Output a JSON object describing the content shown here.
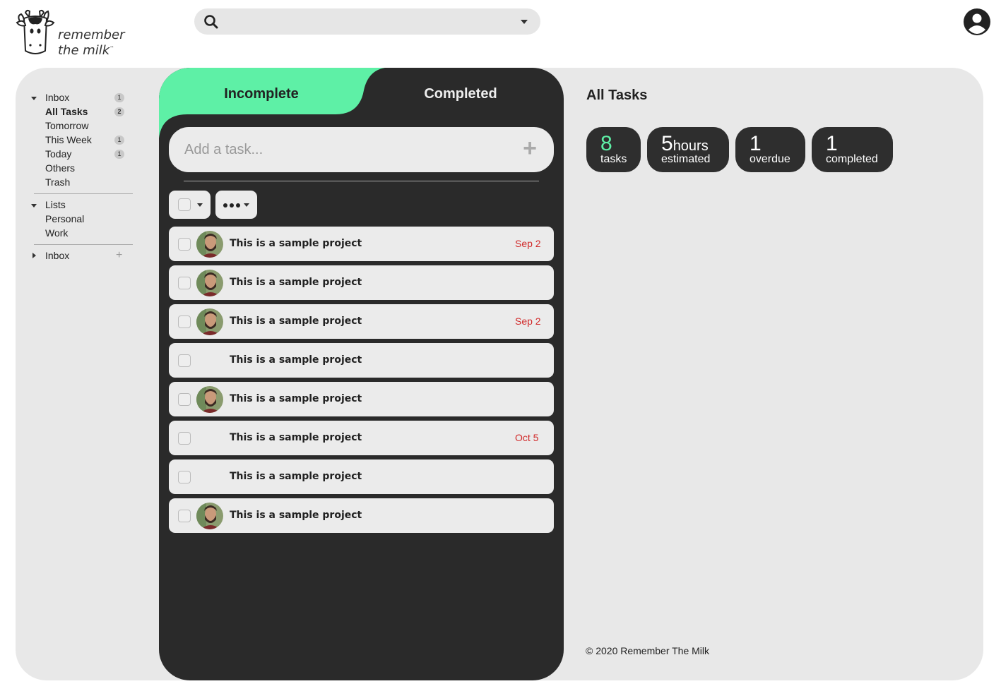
{
  "brand": {
    "line1": "remember",
    "line2": "the milk",
    "tm": "™"
  },
  "search": {
    "placeholder": ""
  },
  "sidebar": {
    "groups": [
      {
        "label": "Inbox",
        "badge": "1"
      },
      {
        "label": "All Tasks",
        "badge": "2"
      },
      {
        "label": "Tomorrow",
        "badge": ""
      },
      {
        "label": "This Week",
        "badge": "1"
      },
      {
        "label": "Today",
        "badge": "1"
      },
      {
        "label": "Others",
        "badge": ""
      },
      {
        "label": "Trash",
        "badge": ""
      }
    ],
    "lists_header": "Lists",
    "lists": [
      "Personal",
      "Work"
    ],
    "inbox2": "Inbox",
    "inbox2_add": "+"
  },
  "tabs": {
    "incomplete": "Incomplete",
    "completed": "Completed"
  },
  "add_task": {
    "placeholder": "Add a task...",
    "plus": "+"
  },
  "tasks": [
    {
      "title": "This is a sample project",
      "due": "Sep 2",
      "avatar": true
    },
    {
      "title": "This is a sample project",
      "due": "",
      "avatar": true
    },
    {
      "title": "This is a sample project",
      "due": "Sep 2",
      "avatar": true
    },
    {
      "title": "This is a sample project",
      "due": "",
      "avatar": false
    },
    {
      "title": "This is a sample project",
      "due": "",
      "avatar": true
    },
    {
      "title": "This is a sample project",
      "due": "Oct 5",
      "avatar": false
    },
    {
      "title": "This is a sample project",
      "due": "",
      "avatar": false
    },
    {
      "title": "This is a sample project",
      "due": "",
      "avatar": true
    }
  ],
  "right": {
    "title": "All Tasks",
    "stats": [
      {
        "num": "8",
        "unit": "",
        "label": "tasks"
      },
      {
        "num": "5",
        "unit": "hours",
        "label": "estimated"
      },
      {
        "num": "1",
        "unit": "",
        "label": "overdue"
      },
      {
        "num": "1",
        "unit": "",
        "label": "completed"
      }
    ],
    "copyright": "© 2020 Remember The Milk"
  },
  "colors": {
    "accent": "#5ef0a6",
    "panel": "#2a2a2a",
    "due": "#d12a2a",
    "bg": "#e8e8e8"
  }
}
